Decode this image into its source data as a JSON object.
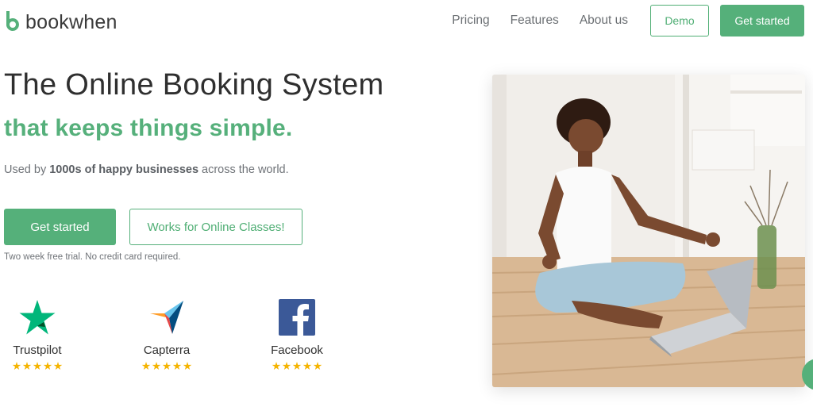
{
  "brand": {
    "name": "bookwhen",
    "color": "#55b07a"
  },
  "nav": {
    "items": [
      "Pricing",
      "Features",
      "About us"
    ],
    "demo_label": "Demo",
    "get_started_label": "Get started"
  },
  "hero": {
    "title": "The Online Booking System",
    "subtitle": "that keeps things simple.",
    "used_by_prefix": "Used by ",
    "used_by_bold": "1000s of happy businesses",
    "used_by_suffix": " across the world.",
    "primary_cta": "Get started",
    "secondary_cta": "Works for Online Classes!",
    "trial_note": "Two week free trial. No credit card required."
  },
  "reviews": [
    {
      "name": "Trustpilot",
      "icon": "trustpilot-star-icon",
      "stars": 5
    },
    {
      "name": "Capterra",
      "icon": "capterra-arrow-icon",
      "stars": 5
    },
    {
      "name": "Facebook",
      "icon": "facebook-icon",
      "stars": 5
    }
  ],
  "image": {
    "icon": "yoga-meditation-photo"
  }
}
